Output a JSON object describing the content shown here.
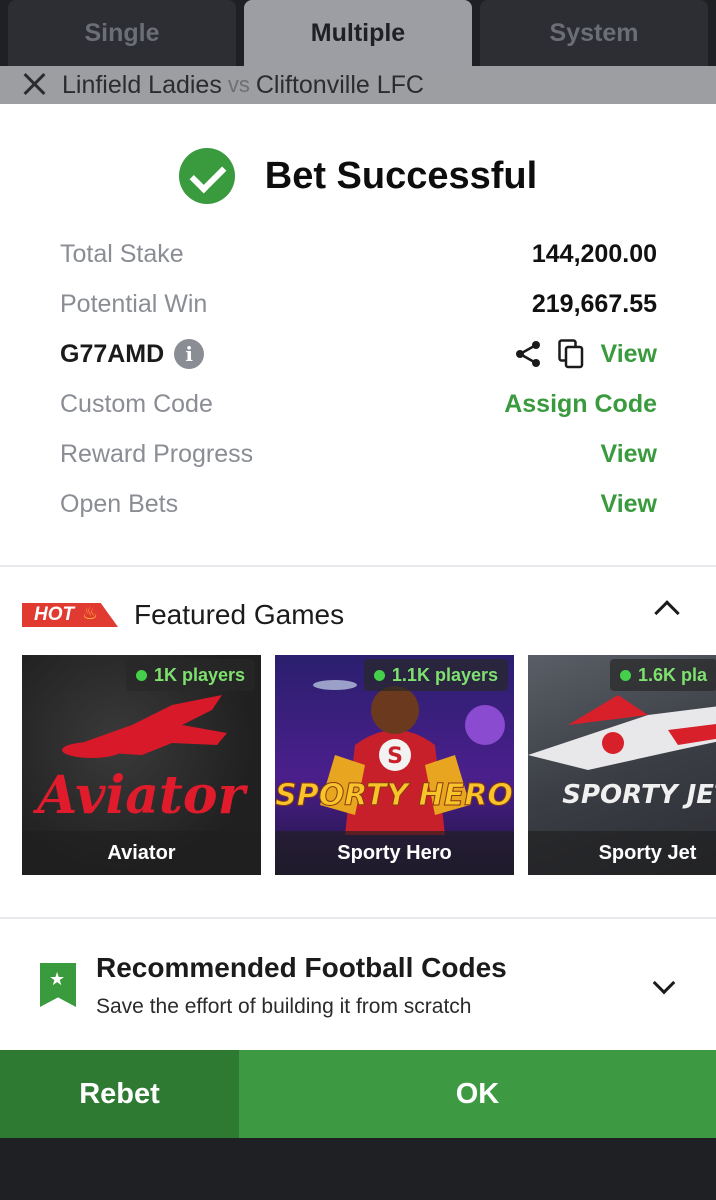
{
  "tabs": [
    {
      "label": "Single"
    },
    {
      "label": "Multiple"
    },
    {
      "label": "System"
    }
  ],
  "match": {
    "home": "Linfield Ladies",
    "vs": "vs",
    "away": "Cliftonville LFC"
  },
  "success": {
    "title": "Bet Successful"
  },
  "summary": {
    "total_stake_label": "Total Stake",
    "total_stake_value": "144,200.00",
    "potential_win_label": "Potential Win",
    "potential_win_value": "219,667.55",
    "booking_code": "G77AMD",
    "info_glyph": "i",
    "view_label": "View",
    "custom_code_label": "Custom Code",
    "assign_code_label": "Assign Code",
    "reward_progress_label": "Reward Progress",
    "reward_view_label": "View",
    "open_bets_label": "Open Bets",
    "open_bets_view_label": "View"
  },
  "featured": {
    "badge": "HOT",
    "title": "Featured Games",
    "games": [
      {
        "name": "Aviator",
        "players": "1K players",
        "art_text": "Aviator"
      },
      {
        "name": "Sporty Hero",
        "players": "1.1K players",
        "art_text": "SPORTY HERO"
      },
      {
        "name": "Sporty Jet",
        "players": "1.6K pla",
        "art_text": "SPORTY JET"
      }
    ]
  },
  "recommended": {
    "title": "Recommended Football Codes",
    "subtitle": "Save the effort of building it from scratch"
  },
  "buttons": {
    "rebet": "Rebet",
    "ok": "OK"
  },
  "colors": {
    "accent_green": "#3a9a3e",
    "ok_green": "#3e9a42",
    "rebet_green": "#2e7a32",
    "hot_red": "#e03a31",
    "players_green": "#7ee06e"
  }
}
